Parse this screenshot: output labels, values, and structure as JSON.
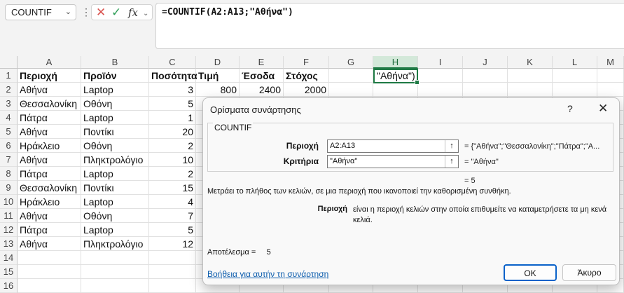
{
  "formula_bar": {
    "name_box": "COUNTIF",
    "formula": "=COUNTIF(A2:A13;\"Αθήνα\")"
  },
  "columns": [
    "A",
    "B",
    "C",
    "D",
    "E",
    "F",
    "G",
    "H",
    "I",
    "J",
    "K",
    "L",
    "M"
  ],
  "selected_column": "H",
  "rows": [
    "1",
    "2",
    "3",
    "4",
    "5",
    "6",
    "7",
    "8",
    "9",
    "10",
    "11",
    "12",
    "13",
    "14",
    "15",
    "16"
  ],
  "header_row": {
    "A": "Περιοχή",
    "B": "Προϊόν",
    "C": "Ποσότητα",
    "D": "Τιμή",
    "E": "Έσοδα",
    "F": "Στόχος"
  },
  "row2_extra": {
    "D": "800",
    "E": "2400",
    "F": "2000"
  },
  "active_cell_text": "\"Αθήνα\")",
  "data_rows": [
    {
      "region": "Αθήνα",
      "product": "Laptop",
      "qty": "3"
    },
    {
      "region": "Θεσσαλονίκη",
      "product": "Οθόνη",
      "qty": "5"
    },
    {
      "region": "Πάτρα",
      "product": "Laptop",
      "qty": "1"
    },
    {
      "region": "Αθήνα",
      "product": "Ποντίκι",
      "qty": "20"
    },
    {
      "region": "Ηράκλειο",
      "product": "Οθόνη",
      "qty": "2"
    },
    {
      "region": "Αθήνα",
      "product": "Πληκτρολόγιο",
      "qty": "10"
    },
    {
      "region": "Πάτρα",
      "product": "Laptop",
      "qty": "2"
    },
    {
      "region": "Θεσσαλονίκη",
      "product": "Ποντίκι",
      "qty": "15"
    },
    {
      "region": "Ηράκλειο",
      "product": "Laptop",
      "qty": "4"
    },
    {
      "region": "Αθήνα",
      "product": "Οθόνη",
      "qty": "7"
    },
    {
      "region": "Πάτρα",
      "product": "Laptop",
      "qty": "5"
    },
    {
      "region": "Αθήνα",
      "product": "Πληκτρολόγιο",
      "qty": "12"
    }
  ],
  "dialog": {
    "title": "Ορίσματα συνάρτησης",
    "help": "?",
    "function_name": "COUNTIF",
    "arg1_label": "Περιοχή",
    "arg1_value": "A2:A13",
    "arg1_result": "= {\"Αθήνα\";\"Θεσσαλονίκη\";\"Πάτρα\";\"Α...",
    "arg2_label": "Κριτήρια",
    "arg2_value": "\"Αθήνα\"",
    "arg2_result": "= \"Αθήνα\"",
    "formula_result": "= 5",
    "description": "Μετράει το πλήθος των κελιών, σε μια περιοχή που ικανοποιεί την καθορισμένη συνθήκη.",
    "arg_desc_label": "Περιοχή",
    "arg_desc_text": "είναι η περιοχή κελιών στην οποία επιθυμείτε να καταμετρήσετε τα μη κενά κελιά.",
    "result_label": "Αποτέλεσμα =",
    "result_value": "5",
    "help_link": "Βοήθεια για αυτήν τη συνάρτηση",
    "ok": "OK",
    "cancel": "Άκυρο"
  }
}
